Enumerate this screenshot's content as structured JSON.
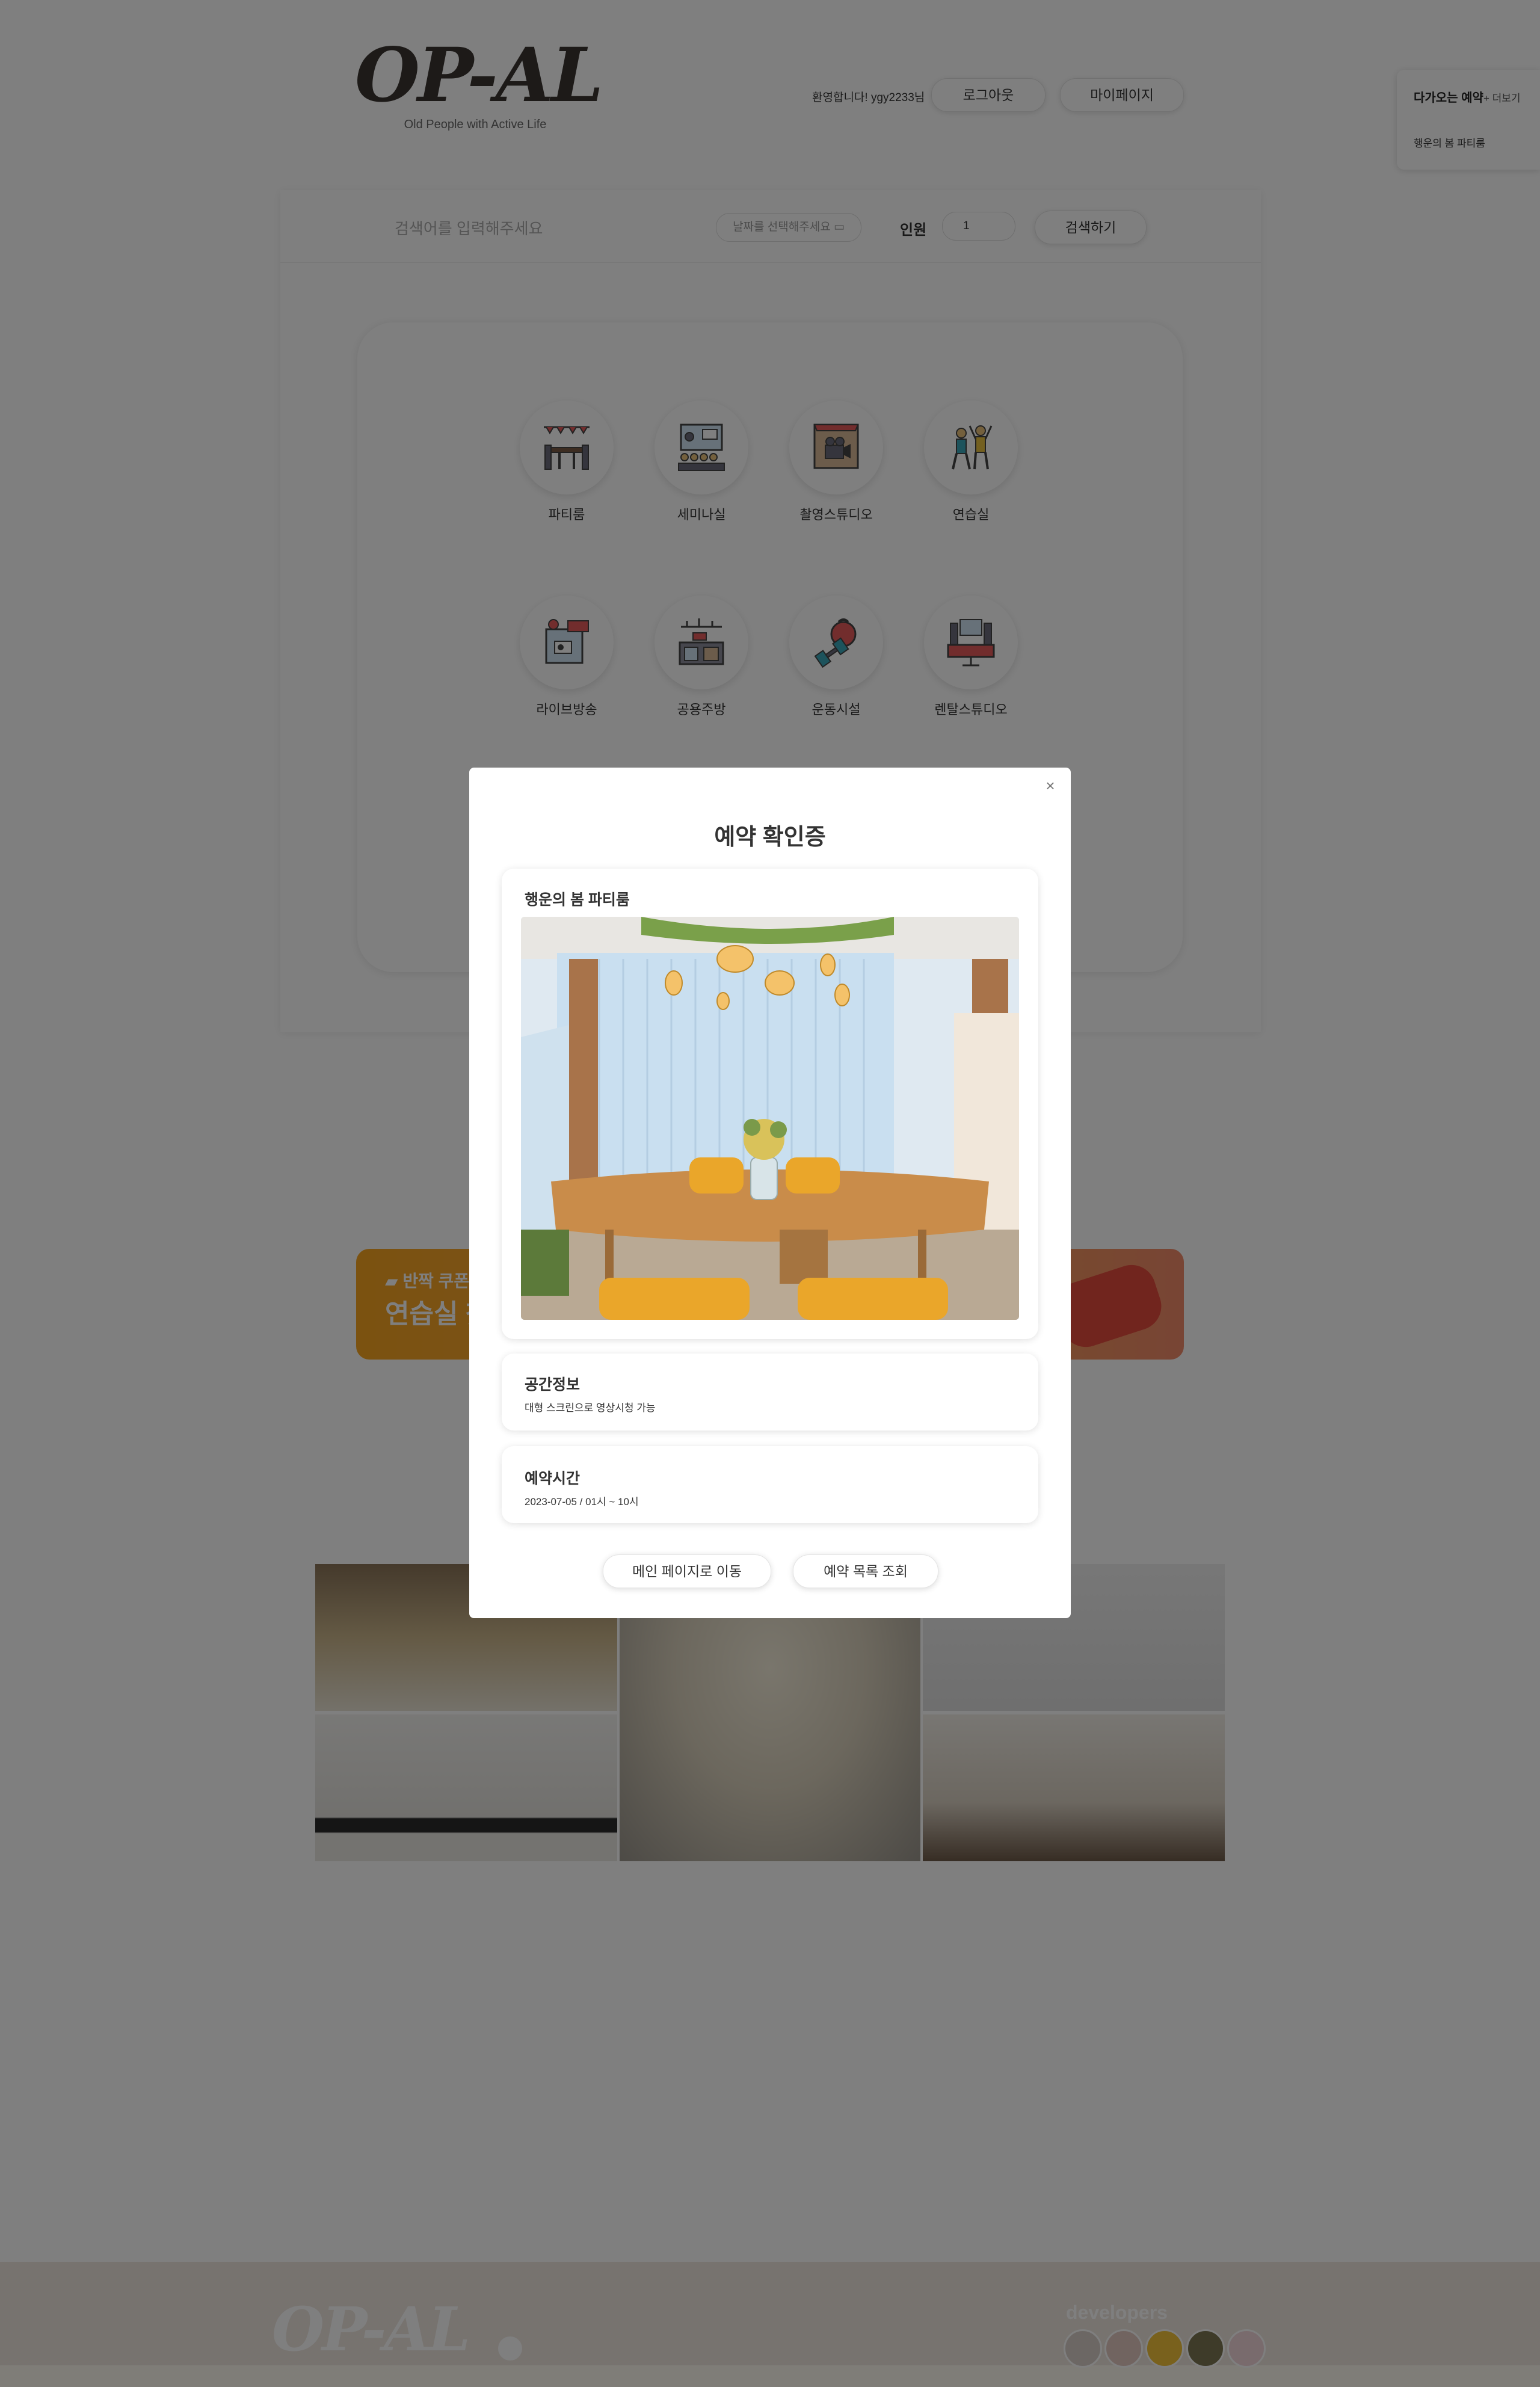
{
  "header": {
    "logo": "OP-AL",
    "slogan": "Old People with Active Life",
    "welcome": "환영합니다! ygy2233님",
    "logout_label": "로그아웃",
    "mypage_label": "마이페이지"
  },
  "upcoming": {
    "title": "다가오는 예약",
    "more": "+ 더보기",
    "item": "행운의 봄 파티룸"
  },
  "search": {
    "placeholder": "검색어를 입력해주세요",
    "date_placeholder": "날짜를 선택해주세요",
    "people_label": "인원",
    "people_value": "1",
    "button_label": "검색하기"
  },
  "categories": [
    {
      "label": "파티룸",
      "icon": "party-icon"
    },
    {
      "label": "세미나실",
      "icon": "seminar-icon"
    },
    {
      "label": "촬영스튜디오",
      "icon": "camera-icon"
    },
    {
      "label": "연습실",
      "icon": "dance-icon"
    },
    {
      "label": "라이브방송",
      "icon": "live-icon"
    },
    {
      "label": "공용주방",
      "icon": "kitchen-icon"
    },
    {
      "label": "운동시설",
      "icon": "dumbbell-icon"
    },
    {
      "label": "렌탈스튜디오",
      "icon": "studio-icon"
    }
  ],
  "banner": {
    "line1": "반짝 쿠폰",
    "line2": "연습실 찾"
  },
  "footer": {
    "logo": "OP-AL",
    "developers_label": "developers"
  },
  "modal": {
    "title": "예약 확인증",
    "close": "×",
    "room_name": "행운의 봄 파티룸",
    "space_info_title": "공간정보",
    "space_info": "대형 스크린으로 영상시청 가능",
    "time_title": "예약시간",
    "time_value": "2023-07-05 / 01시 ~ 10시",
    "main_button": "메인 페이지로 이동",
    "list_button": "예약 목록 조회"
  },
  "colors": {
    "accent_orange": "#f7a520",
    "footer_bg": "#efe6df",
    "logo": "#3a3430"
  }
}
